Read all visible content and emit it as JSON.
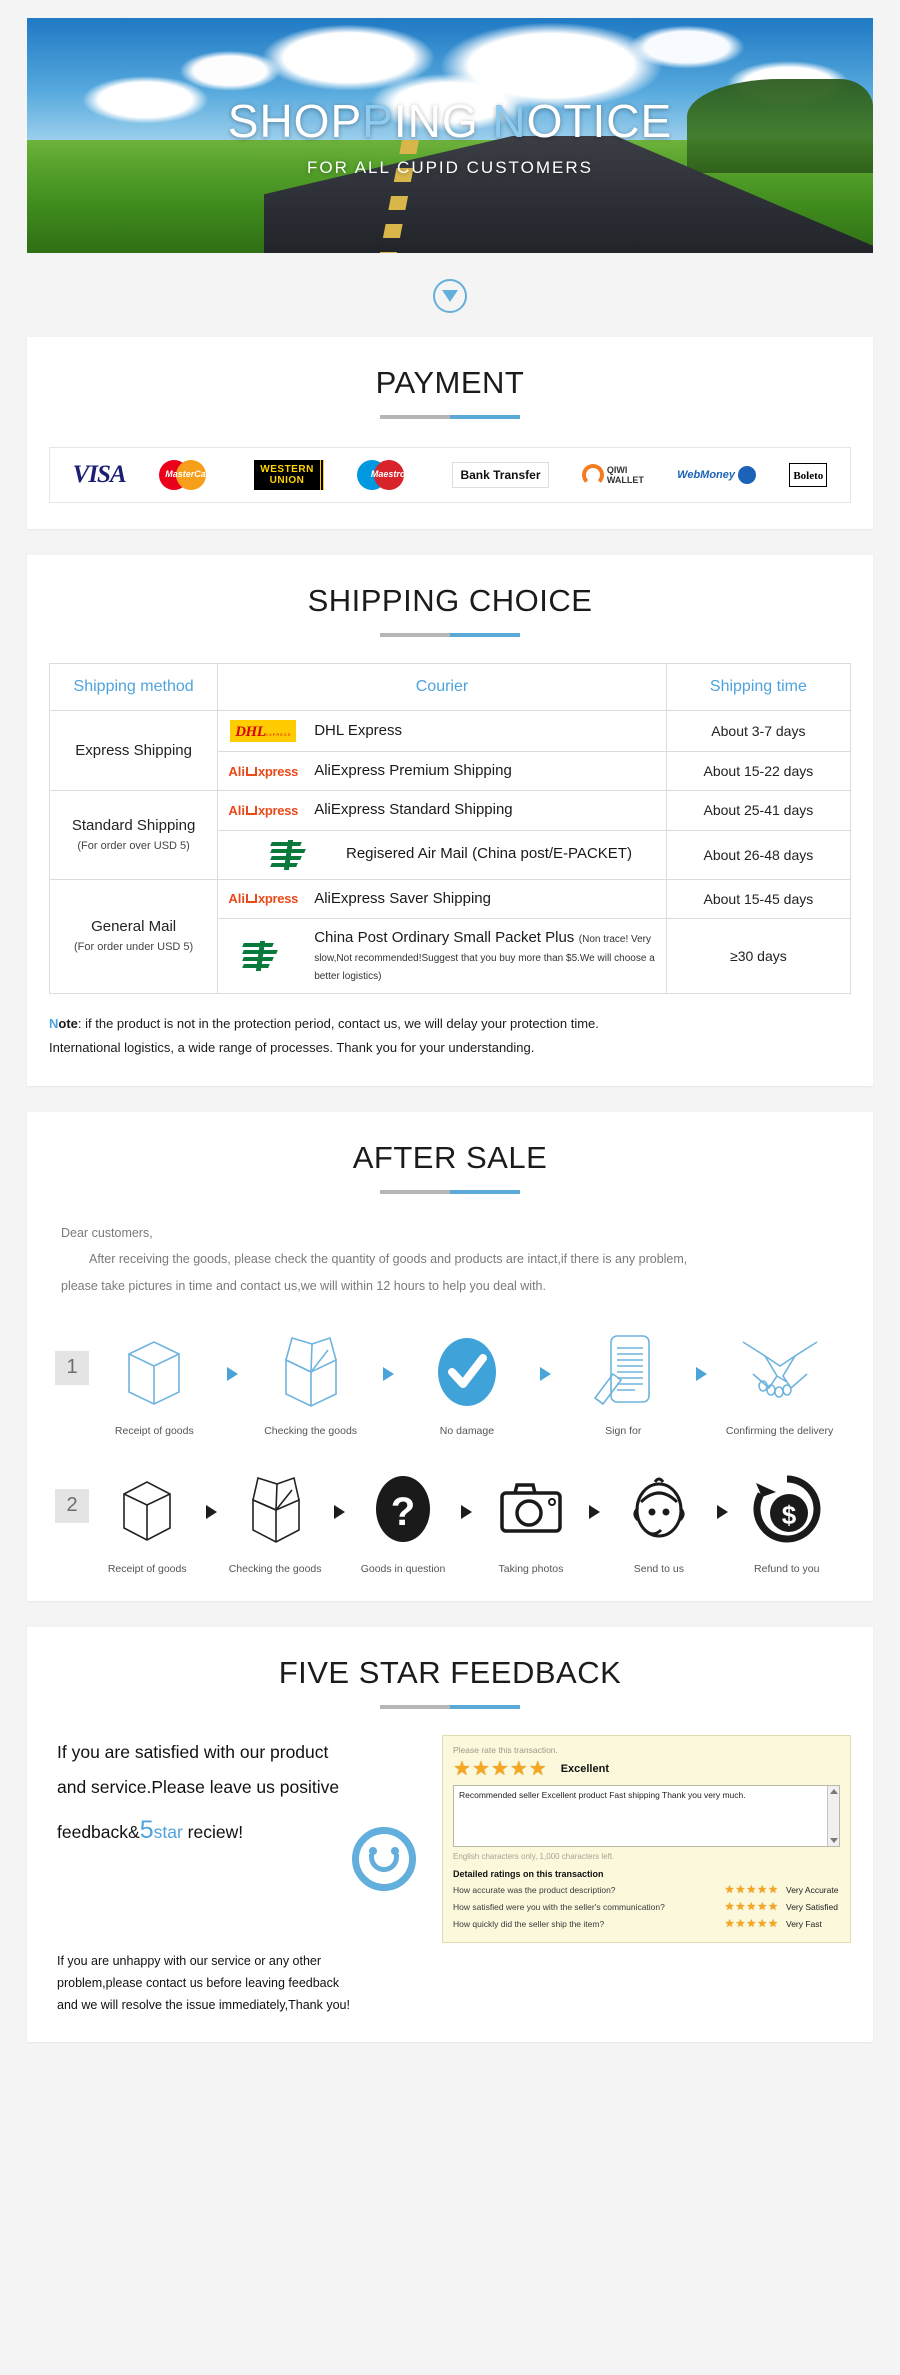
{
  "banner": {
    "title_part1": "SHOP",
    "title_hl1": "P",
    "title_part2": "ING ",
    "title_hl2": "N",
    "title_part3": "OTICE",
    "subtitle": "FOR ALL CUPID CUSTOMERS"
  },
  "scroll_arrow": {
    "icon": "chevron-down-icon"
  },
  "payment": {
    "title": "PAYMENT",
    "methods": [
      {
        "name": "VISA",
        "label": "VISA"
      },
      {
        "name": "MasterCard",
        "label": "MasterCard"
      },
      {
        "name": "Western Union",
        "line1": "WESTERN",
        "line2": "UNION"
      },
      {
        "name": "Maestro",
        "label": "Maestro"
      },
      {
        "name": "Bank Transfer",
        "label": "Bank Transfer"
      },
      {
        "name": "QIWI Wallet",
        "line1": "QIWI",
        "line2": "WALLET"
      },
      {
        "name": "WebMoney",
        "label": "WebMoney"
      },
      {
        "name": "Boleto",
        "label": "Boleto"
      }
    ]
  },
  "shipping": {
    "title": "SHIPPING CHOICE",
    "headers": {
      "method": "Shipping method",
      "courier": "Courier",
      "time": "Shipping time"
    },
    "groups": [
      {
        "method": "Express Shipping",
        "method_sub": "",
        "rows": [
          {
            "logo": "dhl",
            "courier": "DHL Express",
            "courier_line2": "",
            "note": "",
            "time": "About 3-7 days",
            "centered": false
          },
          {
            "logo": "aliexpress",
            "courier": "AliExpress Premium Shipping",
            "courier_line2": "",
            "note": "",
            "time": "About 15-22 days",
            "centered": false
          }
        ]
      },
      {
        "method": "Standard Shipping",
        "method_sub": "(For order over USD 5)",
        "rows": [
          {
            "logo": "aliexpress",
            "courier": "AliExpress Standard Shipping",
            "courier_line2": "",
            "note": "",
            "time": "About 25-41 days",
            "centered": false
          },
          {
            "logo": "chinapost",
            "courier": "Regisered Air Mail",
            "courier_line2": "(China post/E-PACKET)",
            "note": "",
            "time": "About 26-48 days",
            "centered": true
          }
        ]
      },
      {
        "method": "General Mail",
        "method_sub": "(For order under USD 5)",
        "rows": [
          {
            "logo": "aliexpress",
            "courier": "AliExpress Saver Shipping",
            "courier_line2": "",
            "note": "",
            "time": "About 15-45 days",
            "centered": false
          },
          {
            "logo": "chinapost",
            "courier": "China Post Ordinary Small Packet Plus",
            "courier_line2": "",
            "note": "(Non trace!  Very slow,Not recommended!Suggest that you buy more than $5.We will choose a better logistics)",
            "time": "≥30 days",
            "centered": false
          }
        ]
      }
    ],
    "note_prefix_n": "N",
    "note_prefix_rest": "ote",
    "note_line1": ": if the product is not in the protection period, contact us, we will delay your protection time.",
    "note_line2": "International logistics, a wide range of processes. Thank you for your understanding."
  },
  "after_sale": {
    "title": "AFTER SALE",
    "greeting": "Dear customers,",
    "paragraph1": "After receiving the goods, please check the quantity of goods and products are intact,if there is any problem,",
    "paragraph2": "please take pictures in time and contact us,we will within 12 hours to help you deal with.",
    "flows": [
      {
        "step": "1",
        "color": "blue",
        "items": [
          {
            "icon": "box-icon",
            "label": "Receipt of goods"
          },
          {
            "icon": "open-box-icon",
            "label": "Checking the goods"
          },
          {
            "icon": "check-circle-icon",
            "label": "No damage"
          },
          {
            "icon": "document-sign-icon",
            "label": "Sign for"
          },
          {
            "icon": "handshake-icon",
            "label": "Confirming the delivery"
          }
        ]
      },
      {
        "step": "2",
        "color": "black",
        "items": [
          {
            "icon": "box-icon",
            "label": "Receipt of goods"
          },
          {
            "icon": "open-box-icon",
            "label": "Checking the goods"
          },
          {
            "icon": "question-circle-icon",
            "label": "Goods in question"
          },
          {
            "icon": "camera-icon",
            "label": "Taking photos"
          },
          {
            "icon": "support-agent-icon",
            "label": "Send to us"
          },
          {
            "icon": "refund-dollar-icon",
            "label": "Refund to you"
          }
        ]
      }
    ]
  },
  "feedback": {
    "title": "FIVE STAR FEEDBACK",
    "head_line1": "If you are satisfied with our product",
    "head_line2": "and service.Please leave us positive",
    "head_line3_a": "feedback&",
    "head_big5": "5",
    "head_star": "star",
    "head_line3_b": " reciew!",
    "smiley_icon": "smiley-face-icon",
    "foot_line1": "If you are unhappy with our service or any other",
    "foot_line2": "problem,please contact us before leaving feedback",
    "foot_line3": "and we will resolve the issue immediately,Thank you!",
    "panel": {
      "prompt": "Please rate this transaction.",
      "rating_stars": 5,
      "rating_label": "Excellent",
      "comment": "Recommended seller Excellent product Fast shipping Thank you very much.",
      "char_hint": "English characters only, 1,000 characters left.",
      "detail_title": "Detailed ratings on this transaction",
      "details": [
        {
          "question": "How accurate was the product description?",
          "stars": 5,
          "value": "Very Accurate"
        },
        {
          "question": "How satisfied were you with the seller's communication?",
          "stars": 5,
          "value": "Very Satisfied"
        },
        {
          "question": "How quickly did the seller ship the item?",
          "stars": 5,
          "value": "Very Fast"
        }
      ]
    }
  },
  "colors": {
    "accent_blue": "#4fa3dc",
    "rule_gray": "#b6b6b6",
    "rule_blue": "#5ba9d6",
    "page_bg": "#f4f4f4",
    "star_gold": "#f5a623"
  }
}
